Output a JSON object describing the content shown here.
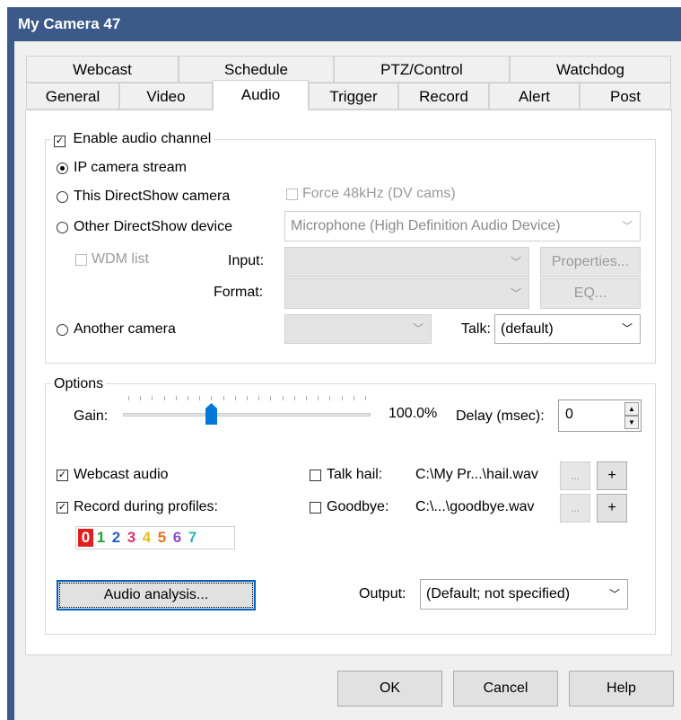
{
  "window": {
    "title": "My Camera 47"
  },
  "tabs": {
    "row1": [
      "Webcast",
      "Schedule",
      "PTZ/Control",
      "Watchdog"
    ],
    "row2": [
      "General",
      "Video",
      "Audio",
      "Trigger",
      "Record",
      "Alert",
      "Post"
    ],
    "active": "Audio"
  },
  "audio": {
    "enable_label": "Enable audio channel",
    "enable_checked": true,
    "source_options": [
      "IP camera stream",
      "This DirectShow camera",
      "Other DirectShow device",
      "Another camera"
    ],
    "selected_source": "IP camera stream",
    "force48_label": "Force 48kHz (DV cams)",
    "device_value": "Microphone (High Definition Audio Device)",
    "wdm_label": "WDM list",
    "input_label": "Input:",
    "format_label": "Format:",
    "properties_label": "Properties...",
    "eq_label": "EQ...",
    "talk_label": "Talk:",
    "talk_value": "(default)"
  },
  "options": {
    "title": "Options",
    "gain_label": "Gain:",
    "gain_percent": "100.0%",
    "gain_level": 0.35,
    "delay_label": "Delay (msec):",
    "delay_value": "0",
    "webcast_audio_label": "Webcast audio",
    "webcast_audio_checked": true,
    "record_profiles_label": "Record during profiles:",
    "record_profiles_checked": true,
    "profiles": [
      {
        "n": "0",
        "color": "#ffffff",
        "bg": "#e02020"
      },
      {
        "n": "1",
        "color": "#1aa33a"
      },
      {
        "n": "2",
        "color": "#2a5cc8"
      },
      {
        "n": "3",
        "color": "#d6336c"
      },
      {
        "n": "4",
        "color": "#e0c020"
      },
      {
        "n": "5",
        "color": "#e8741c"
      },
      {
        "n": "6",
        "color": "#8a4fc8"
      },
      {
        "n": "7",
        "color": "#2cb8b0"
      }
    ],
    "talk_hail_label": "Talk hail:",
    "talk_hail_file": "C:\\My Pr...\\hail.wav",
    "goodbye_label": "Goodbye:",
    "goodbye_file": "C:\\...\\goodbye.wav",
    "browse_label": "...",
    "plus_label": "+",
    "audio_analysis_label": "Audio analysis...",
    "output_label": "Output:",
    "output_value": "(Default; not specified)"
  },
  "footer": {
    "ok": "OK",
    "cancel": "Cancel",
    "help": "Help"
  }
}
